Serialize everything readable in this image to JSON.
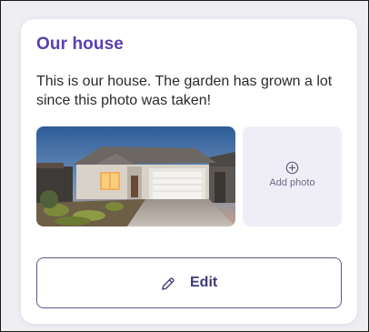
{
  "card": {
    "title": "Our house",
    "description": "This is our house. The garden has grown a lot since this photo was taken!"
  },
  "photos": {
    "add_label": "Add photo",
    "add_icon": "plus-circle-icon"
  },
  "actions": {
    "edit_label": "Edit",
    "edit_icon": "pencil-icon"
  },
  "colors": {
    "title": "#5b3fb0",
    "button_border": "#5b5890",
    "button_text": "#3f3a78",
    "add_photo_bg": "#efeef7"
  }
}
